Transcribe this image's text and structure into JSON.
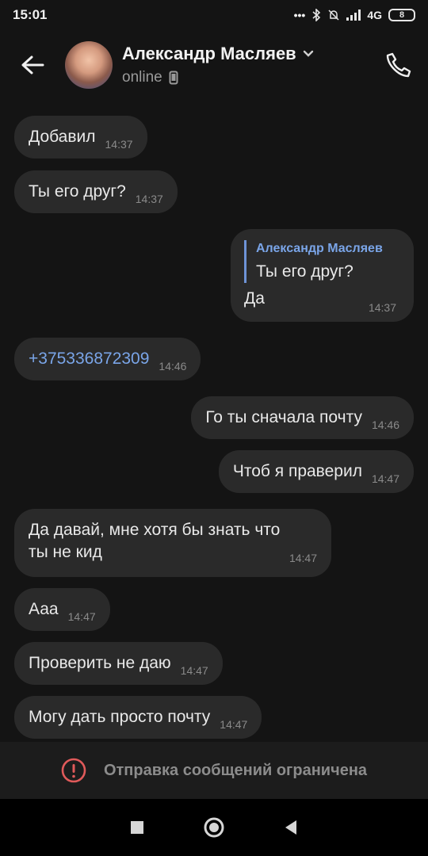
{
  "status_bar": {
    "time": "15:01",
    "network": "4G",
    "battery": "8"
  },
  "header": {
    "contact_name": "Александр Масляев",
    "presence": "online"
  },
  "messages": [
    {
      "text": "Добавил",
      "time": "14:37",
      "side": "incoming"
    },
    {
      "text": "Ты его друг?",
      "time": "14:37",
      "side": "incoming"
    },
    {
      "reply_author": "Александр Масляев",
      "reply_text": "Ты его друг?",
      "text": "Да",
      "time": "14:37",
      "side": "outgoing"
    },
    {
      "text": "+375336872309",
      "time": "14:46",
      "side": "incoming"
    },
    {
      "text": "Го ты сначала почту",
      "time": "14:46",
      "side": "outgoing"
    },
    {
      "text": "Чтоб я праверил",
      "time": "14:47",
      "side": "outgoing"
    },
    {
      "line1": "Да давай, мне хотя бы знать что",
      "line2": "ты не кид",
      "time": "14:47",
      "side": "incoming"
    },
    {
      "text": "Ааа",
      "time": "14:47",
      "side": "incoming"
    },
    {
      "text": "Проверить не даю",
      "time": "14:47",
      "side": "incoming"
    },
    {
      "text": "Могу дать просто почту",
      "time": "14:47",
      "side": "incoming"
    }
  ],
  "footer": {
    "restricted_text": "Отправка сообщений ограничена"
  },
  "colors": {
    "bg": "#141414",
    "bubble": "#2a2a2a",
    "link": "#7aa5e8",
    "alert": "#e05a5a"
  },
  "icons": [
    "back-arrow-icon",
    "chevron-down-icon",
    "phone-icon",
    "mobile-device-icon",
    "alert-icon",
    "nav-recents-icon",
    "nav-home-icon",
    "nav-back-icon"
  ]
}
